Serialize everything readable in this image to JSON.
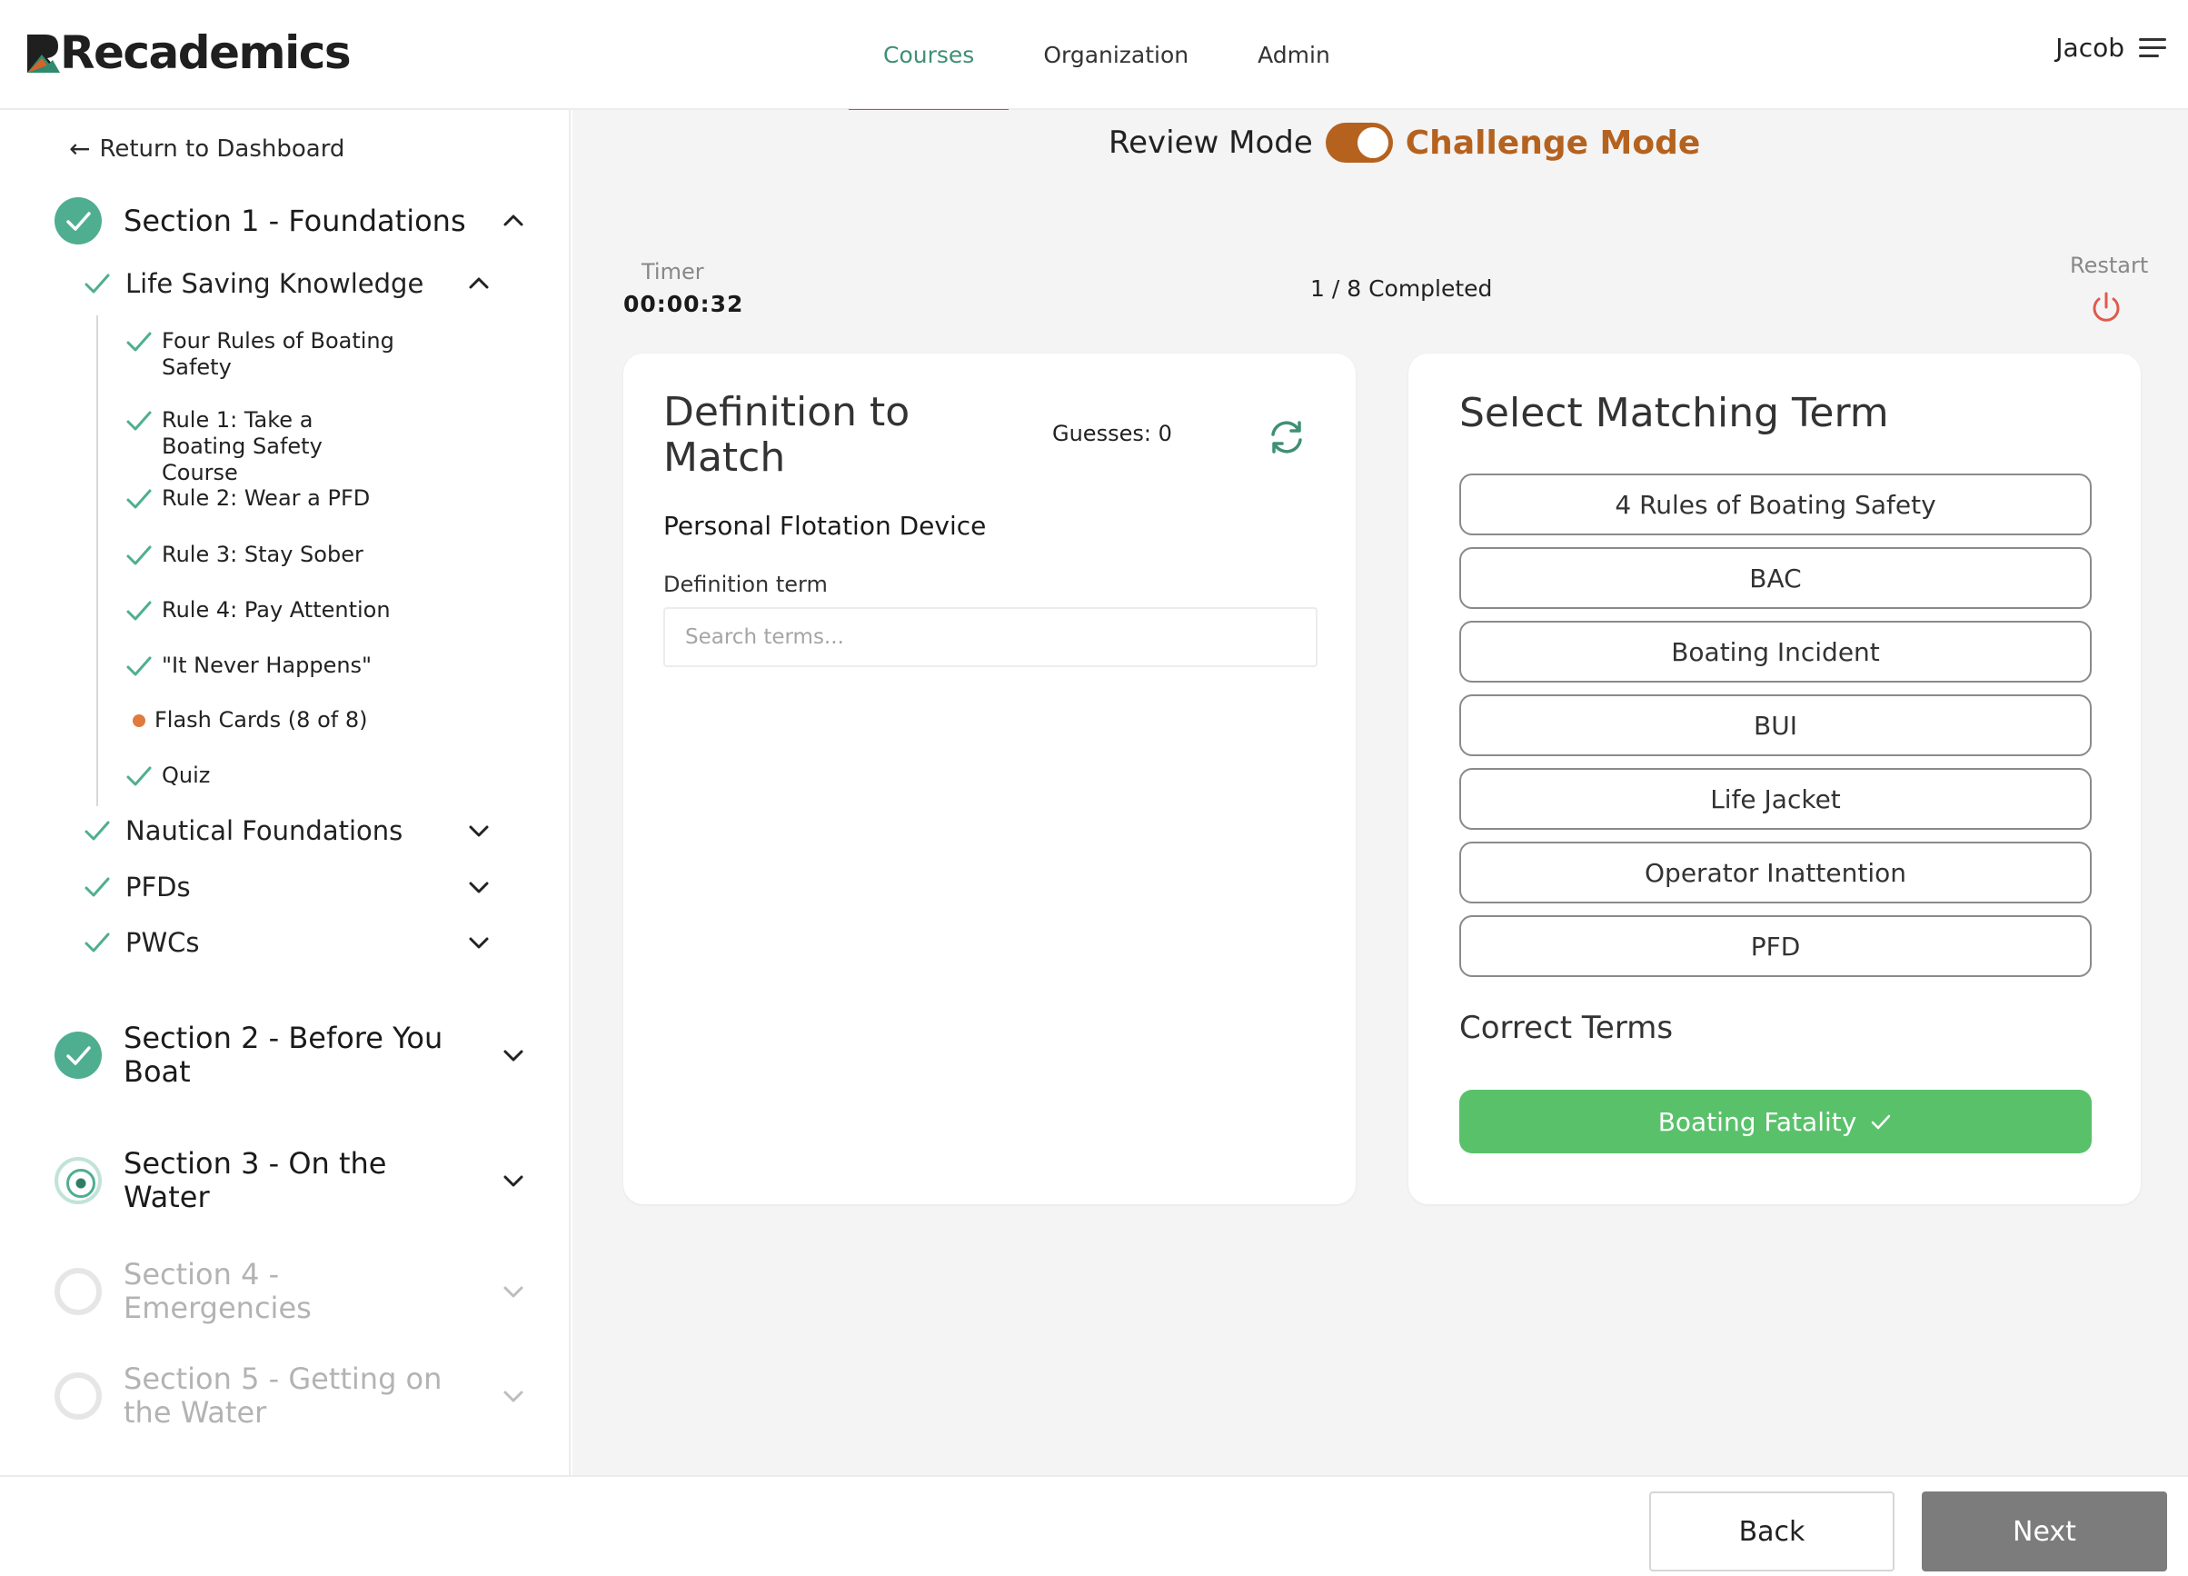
{
  "header": {
    "logo_text": "Recademics",
    "nav": [
      {
        "label": "Courses",
        "active": true
      },
      {
        "label": "Organization",
        "active": false
      },
      {
        "label": "Admin",
        "active": false
      }
    ],
    "user_name": "Jacob"
  },
  "sidebar": {
    "back_label": "Return to Dashboard",
    "sections": [
      {
        "title": "Section 1 - Foundations",
        "status": "complete",
        "expanded": true
      },
      {
        "title": "Section 2 - Before You Boat",
        "status": "complete",
        "expanded": false
      },
      {
        "title": "Section 3 - On the Water",
        "status": "current",
        "expanded": false
      },
      {
        "title": "Section 4 - Emergencies",
        "status": "locked",
        "expanded": false
      },
      {
        "title": "Section 5 - Getting on the Water",
        "status": "locked",
        "expanded": false
      }
    ],
    "subsections": [
      {
        "title": "Life Saving Knowledge",
        "status": "complete",
        "expanded": true
      },
      {
        "title": "Nautical Foundations",
        "status": "complete",
        "expanded": false
      },
      {
        "title": "PFDs",
        "status": "complete",
        "expanded": false
      },
      {
        "title": "PWCs",
        "status": "complete",
        "expanded": false
      }
    ],
    "lessons": [
      {
        "title": "Four Rules of Boating Safety",
        "status": "complete"
      },
      {
        "title": "Rule 1: Take a Boating Safety Course",
        "status": "complete"
      },
      {
        "title": "Rule 2: Wear a PFD",
        "status": "complete"
      },
      {
        "title": "Rule 3: Stay Sober",
        "status": "complete"
      },
      {
        "title": "Rule 4: Pay Attention",
        "status": "complete"
      },
      {
        "title": "\"It Never Happens\"",
        "status": "complete"
      },
      {
        "title": "Flash Cards (8 of 8)",
        "status": "in-progress"
      },
      {
        "title": "Quiz",
        "status": "complete"
      }
    ]
  },
  "main": {
    "mode": {
      "review_label": "Review Mode",
      "challenge_label": "Challenge Mode",
      "active": "challenge"
    },
    "timer_label": "Timer",
    "timer_value": "00:00:32",
    "progress_text": "1 / 8 Completed",
    "restart_label": "Restart",
    "definition": {
      "title": "Definition to Match",
      "guesses_text": "Guesses: 0",
      "text": "Personal Flotation Device",
      "field_label": "Definition term",
      "search_placeholder": "Search terms..."
    },
    "terms": {
      "title": "Select Matching Term",
      "options": [
        "4 Rules of Boating Safety",
        "BAC",
        "Boating Incident",
        "BUI",
        "Life Jacket",
        "Operator Inattention",
        "PFD"
      ],
      "correct_title": "Correct Terms",
      "correct": [
        "Boating Fatality"
      ]
    }
  },
  "footer": {
    "back_label": "Back",
    "next_label": "Next"
  },
  "colors": {
    "accent": "#3f8f76",
    "complete": "#4fae90",
    "challenge": "#b5621f",
    "correct": "#5ac16b",
    "in_progress": "#e07a3e",
    "next_button": "#7c7c7c"
  }
}
